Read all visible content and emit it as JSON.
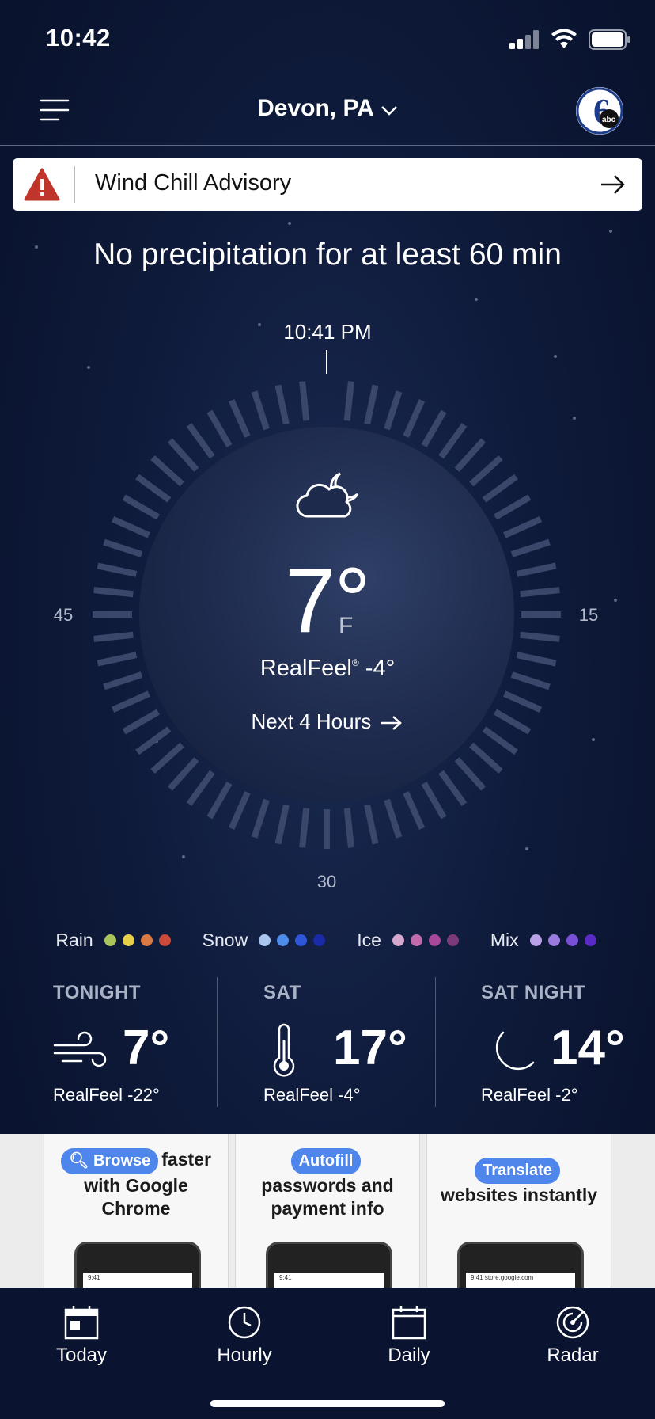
{
  "status_bar": {
    "time": "10:42"
  },
  "header": {
    "location": "Devon, PA",
    "logo_text": "6abc"
  },
  "alert": {
    "title": "Wind Chill Advisory"
  },
  "minutecast": {
    "headline": "No precipitation for at least 60 min",
    "time_label": "10:41 PM",
    "dial_labels": {
      "left": "45",
      "right": "15",
      "bottom": "30"
    }
  },
  "current": {
    "icon": "cloud-moon-icon",
    "temperature": "7°",
    "unit": "F",
    "realfeel_label": "RealFeel",
    "realfeel_mark": "®",
    "realfeel_value": "-4°",
    "next_hours": "Next 4 Hours"
  },
  "legend": [
    {
      "label": "Rain",
      "colors": [
        "#a8c45a",
        "#e6cf4a",
        "#d97a45",
        "#cc4a3a"
      ]
    },
    {
      "label": "Snow",
      "colors": [
        "#a9c6ee",
        "#4d8ce8",
        "#2f55d8",
        "#1a2aa8"
      ]
    },
    {
      "label": "Ice",
      "colors": [
        "#d6a7cf",
        "#c06aac",
        "#a8489a",
        "#7d3a7a"
      ]
    },
    {
      "label": "Mix",
      "colors": [
        "#b9a3e6",
        "#9b7be0",
        "#7a4fd8",
        "#5a2bc4"
      ]
    }
  ],
  "forecast": [
    {
      "label": "TONIGHT",
      "icon": "wind-icon",
      "temp": "7°",
      "realfeel": "RealFeel -22°"
    },
    {
      "label": "SAT",
      "icon": "thermometer-icon",
      "temp": "17°",
      "realfeel": "RealFeel -4°"
    },
    {
      "label": "SAT NIGHT",
      "icon": "moon-icon",
      "temp": "14°",
      "realfeel": "RealFeel -2°"
    }
  ],
  "ad": {
    "cards": [
      {
        "pill": "Browse",
        "text_after_pill": "faster",
        "text": "with Google Chrome",
        "phone_time": "9:41"
      },
      {
        "pill": "Autofill",
        "text": "passwords and payment info",
        "phone_time": "9:41"
      },
      {
        "pill": "Translate",
        "text": "websites instantly",
        "phone_time": "9:41",
        "phone_url": "store.google.com"
      }
    ]
  },
  "tabs": [
    {
      "label": "Today",
      "icon": "calendar-today-icon"
    },
    {
      "label": "Hourly",
      "icon": "clock-icon"
    },
    {
      "label": "Daily",
      "icon": "calendar-icon"
    },
    {
      "label": "Radar",
      "icon": "radar-icon"
    }
  ]
}
